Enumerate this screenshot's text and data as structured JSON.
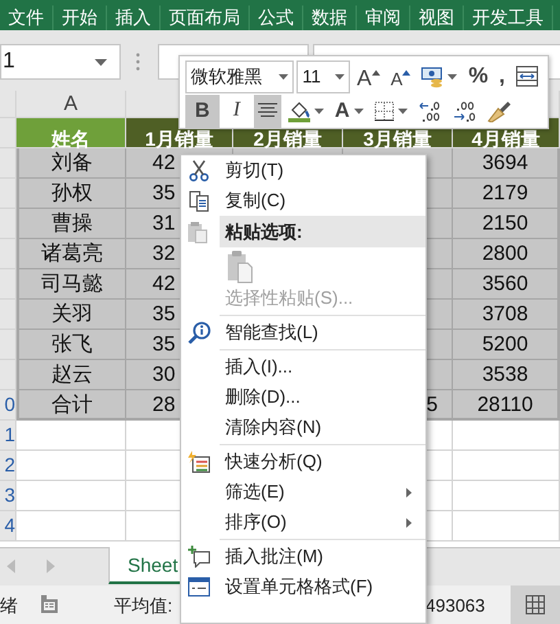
{
  "ribbon_tabs": [
    "文件",
    "开始",
    "插入",
    "页面布局",
    "公式",
    "数据",
    "审阅",
    "视图",
    "开发工具"
  ],
  "name_box": "1",
  "column_headers": [
    "A"
  ],
  "table_header": [
    "姓名",
    "1月销量",
    "2月销量",
    "3月销量",
    "4月销量"
  ],
  "rows": [
    {
      "col_a": "刘备",
      "col_b": "42",
      "col_e": "3694"
    },
    {
      "col_a": "孙权",
      "col_b": "35",
      "col_e": "2179"
    },
    {
      "col_a": "曹操",
      "col_b": "31",
      "col_e": "2150"
    },
    {
      "col_a": "诸葛亮",
      "col_b": "32",
      "col_e": "2800"
    },
    {
      "col_a": "司马懿",
      "col_b": "42",
      "col_e": "3560"
    },
    {
      "col_a": "关羽",
      "col_b": "35",
      "col_e": "3708"
    },
    {
      "col_a": "张飞",
      "col_b": "35",
      "col_e": "5200"
    },
    {
      "col_a": "赵云",
      "col_b": "30",
      "col_e": "3538"
    },
    {
      "row_number": "0",
      "col_a": "合计",
      "col_b": "28",
      "col_d": "5",
      "col_e": "28110"
    }
  ],
  "empty_rows": [
    "1",
    "2",
    "3",
    "4"
  ],
  "sheet_tabs": [
    {
      "label": "Sheet",
      "selected": true
    }
  ],
  "status_bar": {
    "mode": "绪",
    "average": "平均值:",
    "sum": "493063"
  },
  "mini_toolbar": {
    "font": "微软雅黑",
    "size": "11",
    "row1": [
      {
        "kind": "grow",
        "label": "A"
      },
      {
        "kind": "shrink",
        "label": "A"
      },
      {
        "kind": "currency"
      },
      {
        "kind": "glyph",
        "label": "%"
      },
      {
        "kind": "glyph",
        "label": ","
      },
      {
        "kind": "wrap"
      }
    ],
    "row2": [
      {
        "kind": "bold",
        "label": "B",
        "selected": true
      },
      {
        "kind": "italic",
        "label": "I",
        "selected": false
      },
      {
        "kind": "align",
        "selected": true
      },
      {
        "kind": "fill",
        "selected": false
      },
      {
        "kind": "fontcolor",
        "label": "A",
        "selected": false
      },
      {
        "kind": "border",
        "selected": false
      },
      {
        "kind": "decdec",
        "selected": false
      },
      {
        "kind": "incdec",
        "selected": false
      },
      {
        "kind": "painter",
        "selected": false
      }
    ]
  },
  "context_menu": [
    {
      "kind": "cut",
      "label": "剪切(T)",
      "disabled": false,
      "submenu": false
    },
    {
      "kind": "copy",
      "label": "复制(C)",
      "disabled": false,
      "submenu": false
    },
    {
      "kind": "paste_header",
      "label": "粘贴选项:"
    },
    {
      "kind": "paste_option"
    },
    {
      "kind": "plain",
      "label": "选择性粘贴(S)...",
      "disabled": true,
      "submenu": false
    },
    {
      "kind": "separator"
    },
    {
      "kind": "lookup",
      "label": "智能查找(L)",
      "disabled": false,
      "submenu": false
    },
    {
      "kind": "separator"
    },
    {
      "kind": "plain",
      "label": "插入(I)...",
      "disabled": false,
      "submenu": false
    },
    {
      "kind": "plain",
      "label": "删除(D)...",
      "disabled": false,
      "submenu": false
    },
    {
      "kind": "plain",
      "label": "清除内容(N)",
      "disabled": false,
      "submenu": false
    },
    {
      "kind": "separator"
    },
    {
      "kind": "analysis",
      "label": "快速分析(Q)",
      "disabled": false,
      "submenu": false
    },
    {
      "kind": "plain",
      "label": "筛选(E)",
      "disabled": false,
      "submenu": true
    },
    {
      "kind": "plain",
      "label": "排序(O)",
      "disabled": false,
      "submenu": true
    },
    {
      "kind": "separator"
    },
    {
      "kind": "comment",
      "label": "插入批注(M)",
      "disabled": false,
      "submenu": false
    },
    {
      "kind": "format",
      "label": "设置单元格格式(F)",
      "disabled": false,
      "submenu": false
    }
  ]
}
